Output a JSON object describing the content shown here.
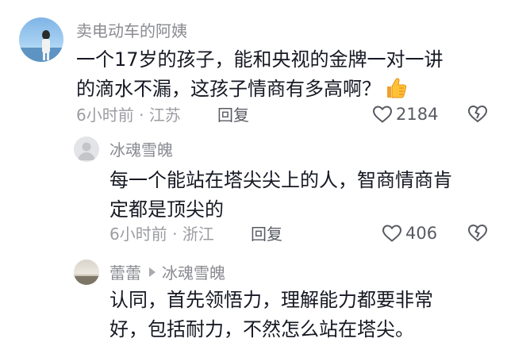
{
  "comments": [
    {
      "username": "卖电动车的阿姨",
      "text_lines": [
        "一个17岁的孩子，能和央视的金牌一对一讲",
        "的滴水不漏，这孩子情商有多高啊？"
      ],
      "emoji": "thumbs-up-icon",
      "time": "6小时前",
      "location": "江苏",
      "reply_label": "回复",
      "likes": "2184"
    },
    {
      "username": "冰魂雪魄",
      "text_lines": [
        "每一个能站在塔尖尖上的人，智商情商肯",
        "定都是顶尖的"
      ],
      "time": "6小时前",
      "location": "浙江",
      "reply_label": "回复",
      "likes": "406"
    },
    {
      "username": "蕾蕾",
      "reply_to": "冰魂雪魄",
      "text_lines": [
        "认同，首先领悟力，理解能力都要非常",
        "好，包括耐力，不然怎么站在塔尖。"
      ]
    }
  ],
  "meta_separator": " · ",
  "colors": {
    "text": "#161823",
    "secondary": "#8a8b91",
    "accent_emoji": "#f5a623"
  }
}
